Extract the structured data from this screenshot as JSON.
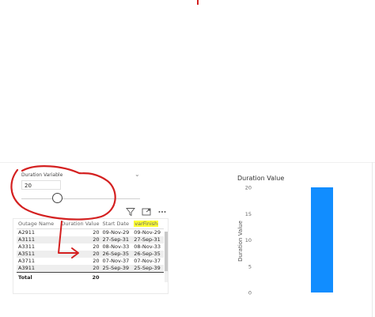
{
  "slicer": {
    "title": "Duration Variable",
    "value": "20",
    "level": 0.3
  },
  "table": {
    "headers": [
      "Outage Name",
      "Duration Value",
      "Start Date",
      "varFinish"
    ],
    "rows": [
      [
        "A2911",
        "20",
        "09-Nov-29",
        "09-Nov-29"
      ],
      [
        "A3111",
        "20",
        "27-Sep-31",
        "27-Sep-31"
      ],
      [
        "A3311",
        "20",
        "08-Nov-33",
        "08-Nov-33"
      ],
      [
        "A3511",
        "20",
        "26-Sep-35",
        "26-Sep-35"
      ],
      [
        "A3711",
        "20",
        "07-Nov-37",
        "07-Nov-37"
      ],
      [
        "A3911",
        "20",
        "25-Sep-39",
        "25-Sep-39"
      ]
    ],
    "total_label": "Total",
    "total_value": "20"
  },
  "icons": [
    "filter-icon",
    "focus-mode-icon",
    "more-options-icon",
    "chevron-down-icon"
  ],
  "colors": {
    "bar": "#118dff",
    "highlight": "#ffff33",
    "annotation": "#d42020"
  },
  "chart_data": {
    "type": "bar",
    "title": "Duration Value",
    "xlabel": "",
    "ylabel": "Duration Value",
    "categories": [
      ""
    ],
    "values": [
      20
    ],
    "ylim": [
      0,
      20
    ],
    "yticks": [
      "0",
      "5",
      "10",
      "15",
      "20"
    ],
    "grid": false,
    "legend": "none"
  }
}
